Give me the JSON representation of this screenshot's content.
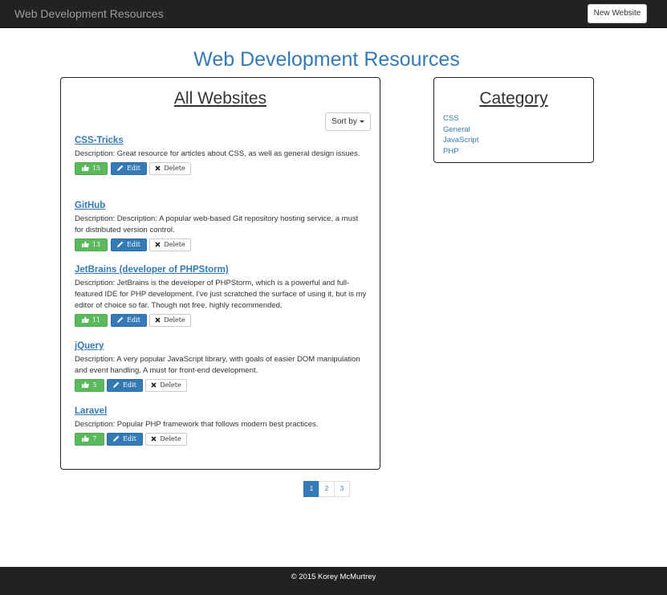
{
  "navbar": {
    "brand": "Web Development Resources",
    "new_website_label": "New Website"
  },
  "page_title": "Web Development Resources",
  "websites_panel": {
    "heading": "All Websites",
    "sort_label": "Sort by",
    "sites": [
      {
        "title": "CSS-Tricks",
        "description": "Description: Great resource for articles about CSS, as well as general design issues.",
        "likes": "15",
        "edit_label": "Edit",
        "delete_label": "Delete"
      },
      {
        "title": "GitHub",
        "description": "Description: Description: A popular web-based Git repository hosting service, a must for distributed version control.",
        "likes": "13",
        "edit_label": "Edit",
        "delete_label": "Delete"
      },
      {
        "title": "JetBrains (developer of PHPStorm)",
        "description": "Description: JetBrains is the developer of PHPStorm, which is a powerful and full-featured IDE for PHP development. I've just scratched the surface of using it, but is my editor of choice so far. Though not free, highly recommended.",
        "likes": "11",
        "edit_label": "Edit",
        "delete_label": "Delete"
      },
      {
        "title": "jQuery",
        "description": "Description: A very popular JavaScript library, with goals of easier DOM manipulation and event handling. A must for front-end development.",
        "likes": "5",
        "edit_label": "Edit",
        "delete_label": "Delete"
      },
      {
        "title": "Laravel",
        "description": "Description: Popular PHP framework that follows modern best practices.",
        "likes": "7",
        "edit_label": "Edit",
        "delete_label": "Delete"
      }
    ]
  },
  "category_panel": {
    "heading": "Category",
    "items": [
      "CSS",
      "General",
      "JavaScript",
      "PHP"
    ]
  },
  "pagination": {
    "pages": [
      "1",
      "2",
      "3"
    ],
    "active": "1"
  },
  "footer": {
    "text": "© 2015 Korey McMurtrey"
  },
  "colors": {
    "brand_blue": "#337ab7",
    "like_green": "#5cb85c",
    "navbar_bg": "#222222"
  }
}
